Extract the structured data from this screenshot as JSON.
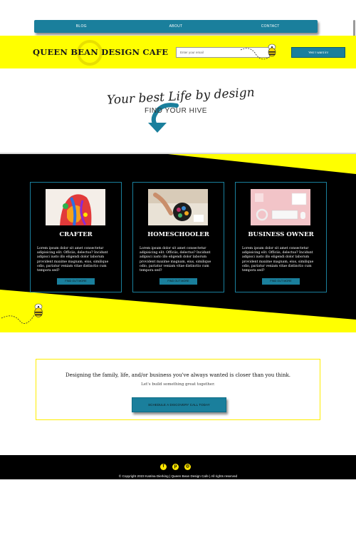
{
  "nav": {
    "items": [
      "BLOG",
      "ABOUT",
      "CONTACT"
    ]
  },
  "header": {
    "brand": "QUEEN BEAN DESIGN CAFE",
    "email_placeholder": "Enter your email",
    "subscribe_label": "Yes! I want in!"
  },
  "hero": {
    "script_text": "Your best Life by design",
    "subtitle": "FIND YOUR HIVE"
  },
  "cards": [
    {
      "title": "CRAFTER",
      "image": "paint-covered-hands-photo",
      "text": "Lorem ipsum dolor sit amet consectetur adipisicing elit. Officiis, delectus? Incidunt adipisci iusto illo eligendi dolor laborum provident maxime magnam, eius, similique odio, pariatur veniam vitae distinctio cum tempora sed?",
      "button": "FIND OUT MORE"
    },
    {
      "title": "HOMESCHOOLER",
      "image": "child-drawing-photo",
      "text": "Lorem ipsum dolor sit amet consectetur adipisicing elit. Officiis, delectus? Incidunt adipisci iusto illo eligendi dolor laborum provident maxime magnam, eius, similique odio, pariatur veniam vitae distinctio cum tempora sed?",
      "button": "FIND OUT MORE"
    },
    {
      "title": "BUSINESS OWNER",
      "image": "pink-desk-workspace-photo",
      "text": "Lorem ipsum dolor sit amet consectetur adipisicing elit. Officiis, delectus? Incidunt adipisci iusto illo eligendi dolor laborum provident maxime magnam, eius, similique odio, pariatur veniam vitae distinctio cum tempora sed?",
      "button": "FIND OUT MORE"
    }
  ],
  "cta": {
    "heading": "Designing the family, life, and/or business you've always wanted is closer than you think.",
    "subheading": "Let's build something great together.",
    "button": "SCHEDULE A DISCOVERY CALL TODAY"
  },
  "footer": {
    "social_icons": [
      "facebook-icon",
      "pinterest-icon",
      "instagram-icon"
    ],
    "copyright": "© Copyright 2023 Katrina Dierking | Queen Bean Design Cafe | All rights reserved"
  },
  "colors": {
    "accent": "#1a7f9c",
    "yellow": "#ffff00",
    "black": "#000000"
  }
}
